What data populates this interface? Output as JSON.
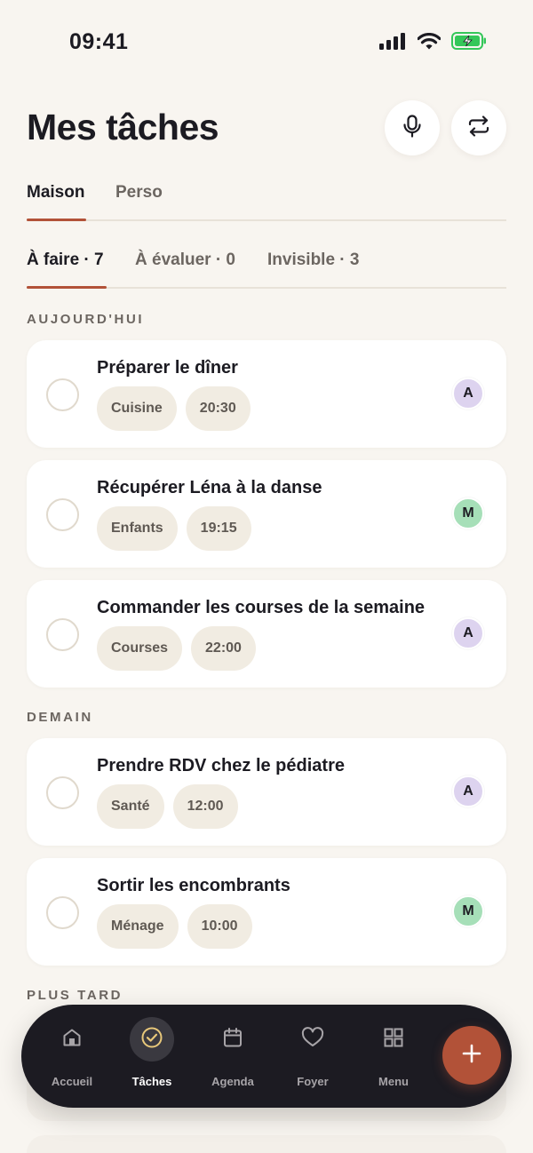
{
  "status_bar": {
    "time": "09:41"
  },
  "header": {
    "title": "Mes tâches"
  },
  "space_tabs": [
    {
      "label": "Maison",
      "active": true
    },
    {
      "label": "Perso",
      "active": false
    }
  ],
  "status_tabs": [
    {
      "label": "À faire · 7",
      "active": true
    },
    {
      "label": "À évaluer · 0",
      "active": false
    },
    {
      "label": "Invisible · 3",
      "active": false
    }
  ],
  "sections": [
    {
      "label": "AUJOURD'HUI",
      "tasks": [
        {
          "title": "Préparer le dîner",
          "category": "Cuisine",
          "time": "20:30",
          "assignee": "A"
        },
        {
          "title": "Récupérer Léna à la danse",
          "category": "Enfants",
          "time": "19:15",
          "assignee": "M"
        },
        {
          "title": "Commander les courses de la semaine",
          "category": "Courses",
          "time": "22:00",
          "assignee": "A"
        }
      ]
    },
    {
      "label": "DEMAIN",
      "tasks": [
        {
          "title": "Prendre RDV chez le pédiatre",
          "category": "Santé",
          "time": "12:00",
          "assignee": "A"
        },
        {
          "title": "Sortir les encombrants",
          "category": "Ménage",
          "time": "10:00",
          "assignee": "M"
        }
      ]
    },
    {
      "label": "PLUS TARD",
      "tasks": []
    }
  ],
  "nav": {
    "items": [
      {
        "label": "Accueil",
        "icon": "home-icon",
        "active": false
      },
      {
        "label": "Tâches",
        "icon": "check-circle-icon",
        "active": true
      },
      {
        "label": "Agenda",
        "icon": "calendar-icon",
        "active": false
      },
      {
        "label": "Foyer",
        "icon": "heart-icon",
        "active": false
      },
      {
        "label": "Menu",
        "icon": "grid-icon",
        "active": false
      }
    ],
    "fab_icon": "plus-icon"
  },
  "colors": {
    "background": "#f8f5f0",
    "accent": "#b25238",
    "nav_background": "#1c1b22",
    "chip_background": "#f1ece2",
    "avatar_a": "#ddd3ef",
    "avatar_m": "#a6dfb8"
  }
}
